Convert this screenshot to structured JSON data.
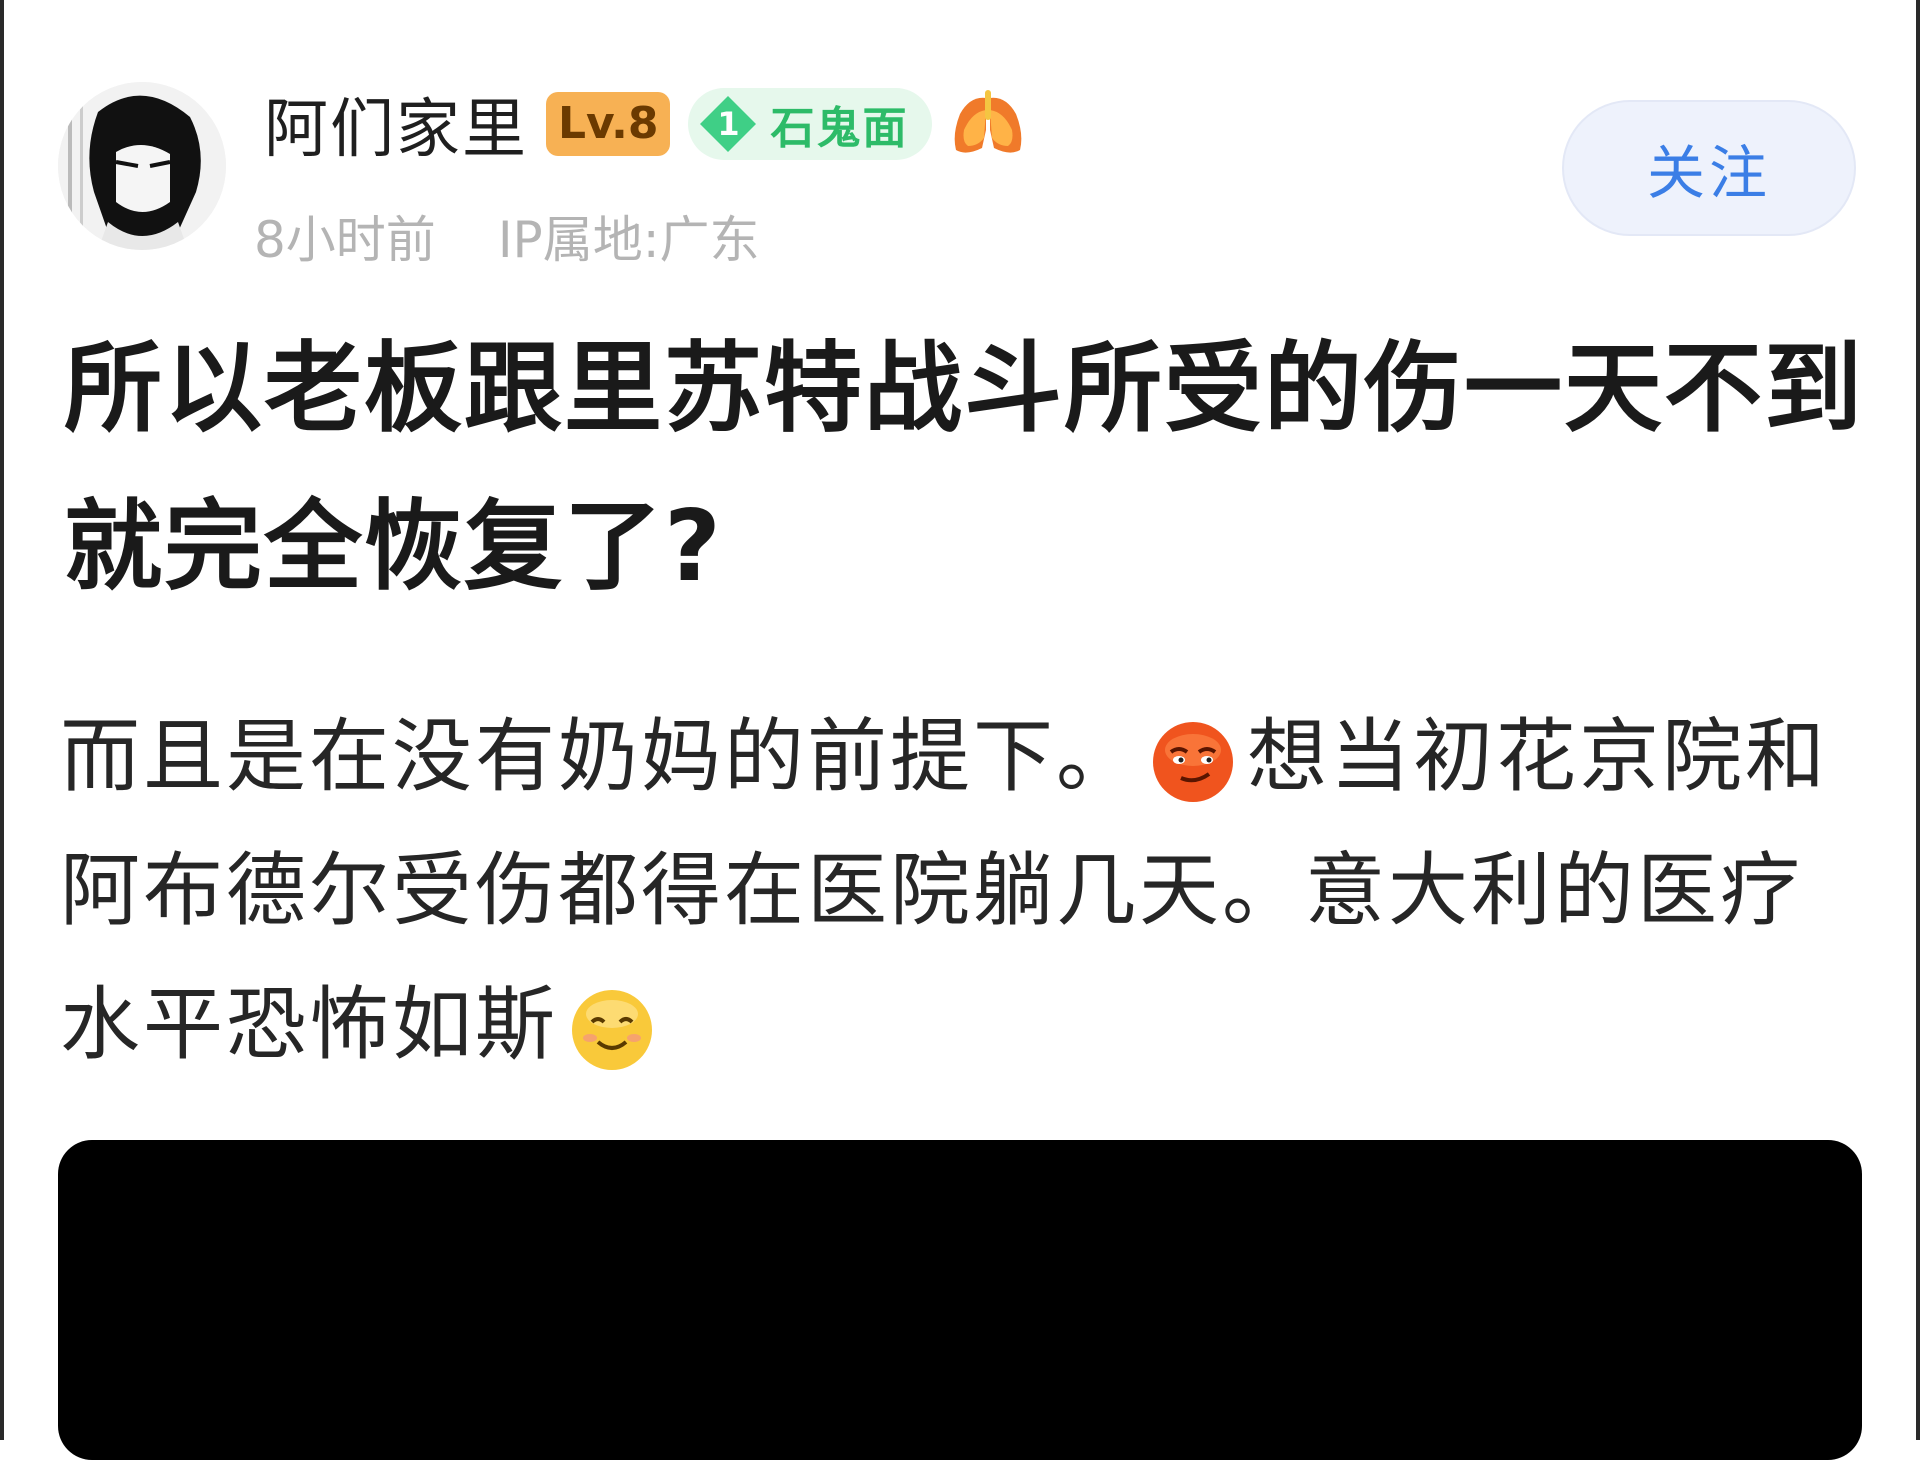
{
  "author": {
    "name": "阿们家里",
    "level": "Lv.8",
    "rank_number": "1",
    "title_badge": "石鬼面",
    "badge_icon": "lungs-icon"
  },
  "meta": {
    "time": "8小时前",
    "ip_location": "IP属地:广东"
  },
  "follow_label": "关注",
  "post": {
    "title": "所以老板跟里苏特战斗所受的伤一天不到就完全恢复了?",
    "body_part1": "而且是在没有奶妈的前提下。",
    "body_part2": "想当初花京院和阿布德尔受伤都得在医院躺几天。意大利的医疗水平恐怖如斯",
    "emojis": [
      "smirk-emoji-icon",
      "smile-emoji-icon"
    ]
  },
  "colors": {
    "follow_text": "#3b7ee6",
    "level_badge": "#f7b154",
    "tag_text": "#2dbb68",
    "meta_text": "#b4b4b4"
  }
}
